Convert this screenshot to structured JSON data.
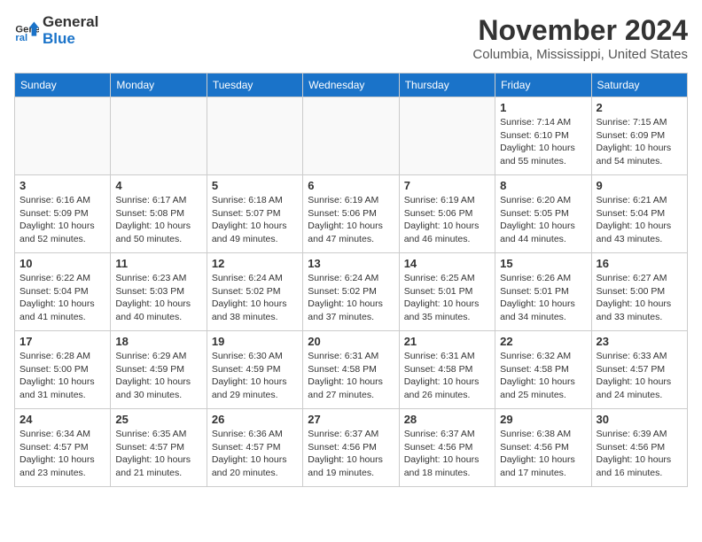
{
  "logo": {
    "line1": "General",
    "line2": "Blue"
  },
  "title": "November 2024",
  "location": "Columbia, Mississippi, United States",
  "days_of_week": [
    "Sunday",
    "Monday",
    "Tuesday",
    "Wednesday",
    "Thursday",
    "Friday",
    "Saturday"
  ],
  "weeks": [
    [
      {
        "day": "",
        "info": ""
      },
      {
        "day": "",
        "info": ""
      },
      {
        "day": "",
        "info": ""
      },
      {
        "day": "",
        "info": ""
      },
      {
        "day": "",
        "info": ""
      },
      {
        "day": "1",
        "info": "Sunrise: 7:14 AM\nSunset: 6:10 PM\nDaylight: 10 hours and 55 minutes."
      },
      {
        "day": "2",
        "info": "Sunrise: 7:15 AM\nSunset: 6:09 PM\nDaylight: 10 hours and 54 minutes."
      }
    ],
    [
      {
        "day": "3",
        "info": "Sunrise: 6:16 AM\nSunset: 5:09 PM\nDaylight: 10 hours and 52 minutes."
      },
      {
        "day": "4",
        "info": "Sunrise: 6:17 AM\nSunset: 5:08 PM\nDaylight: 10 hours and 50 minutes."
      },
      {
        "day": "5",
        "info": "Sunrise: 6:18 AM\nSunset: 5:07 PM\nDaylight: 10 hours and 49 minutes."
      },
      {
        "day": "6",
        "info": "Sunrise: 6:19 AM\nSunset: 5:06 PM\nDaylight: 10 hours and 47 minutes."
      },
      {
        "day": "7",
        "info": "Sunrise: 6:19 AM\nSunset: 5:06 PM\nDaylight: 10 hours and 46 minutes."
      },
      {
        "day": "8",
        "info": "Sunrise: 6:20 AM\nSunset: 5:05 PM\nDaylight: 10 hours and 44 minutes."
      },
      {
        "day": "9",
        "info": "Sunrise: 6:21 AM\nSunset: 5:04 PM\nDaylight: 10 hours and 43 minutes."
      }
    ],
    [
      {
        "day": "10",
        "info": "Sunrise: 6:22 AM\nSunset: 5:04 PM\nDaylight: 10 hours and 41 minutes."
      },
      {
        "day": "11",
        "info": "Sunrise: 6:23 AM\nSunset: 5:03 PM\nDaylight: 10 hours and 40 minutes."
      },
      {
        "day": "12",
        "info": "Sunrise: 6:24 AM\nSunset: 5:02 PM\nDaylight: 10 hours and 38 minutes."
      },
      {
        "day": "13",
        "info": "Sunrise: 6:24 AM\nSunset: 5:02 PM\nDaylight: 10 hours and 37 minutes."
      },
      {
        "day": "14",
        "info": "Sunrise: 6:25 AM\nSunset: 5:01 PM\nDaylight: 10 hours and 35 minutes."
      },
      {
        "day": "15",
        "info": "Sunrise: 6:26 AM\nSunset: 5:01 PM\nDaylight: 10 hours and 34 minutes."
      },
      {
        "day": "16",
        "info": "Sunrise: 6:27 AM\nSunset: 5:00 PM\nDaylight: 10 hours and 33 minutes."
      }
    ],
    [
      {
        "day": "17",
        "info": "Sunrise: 6:28 AM\nSunset: 5:00 PM\nDaylight: 10 hours and 31 minutes."
      },
      {
        "day": "18",
        "info": "Sunrise: 6:29 AM\nSunset: 4:59 PM\nDaylight: 10 hours and 30 minutes."
      },
      {
        "day": "19",
        "info": "Sunrise: 6:30 AM\nSunset: 4:59 PM\nDaylight: 10 hours and 29 minutes."
      },
      {
        "day": "20",
        "info": "Sunrise: 6:31 AM\nSunset: 4:58 PM\nDaylight: 10 hours and 27 minutes."
      },
      {
        "day": "21",
        "info": "Sunrise: 6:31 AM\nSunset: 4:58 PM\nDaylight: 10 hours and 26 minutes."
      },
      {
        "day": "22",
        "info": "Sunrise: 6:32 AM\nSunset: 4:58 PM\nDaylight: 10 hours and 25 minutes."
      },
      {
        "day": "23",
        "info": "Sunrise: 6:33 AM\nSunset: 4:57 PM\nDaylight: 10 hours and 24 minutes."
      }
    ],
    [
      {
        "day": "24",
        "info": "Sunrise: 6:34 AM\nSunset: 4:57 PM\nDaylight: 10 hours and 23 minutes."
      },
      {
        "day": "25",
        "info": "Sunrise: 6:35 AM\nSunset: 4:57 PM\nDaylight: 10 hours and 21 minutes."
      },
      {
        "day": "26",
        "info": "Sunrise: 6:36 AM\nSunset: 4:57 PM\nDaylight: 10 hours and 20 minutes."
      },
      {
        "day": "27",
        "info": "Sunrise: 6:37 AM\nSunset: 4:56 PM\nDaylight: 10 hours and 19 minutes."
      },
      {
        "day": "28",
        "info": "Sunrise: 6:37 AM\nSunset: 4:56 PM\nDaylight: 10 hours and 18 minutes."
      },
      {
        "day": "29",
        "info": "Sunrise: 6:38 AM\nSunset: 4:56 PM\nDaylight: 10 hours and 17 minutes."
      },
      {
        "day": "30",
        "info": "Sunrise: 6:39 AM\nSunset: 4:56 PM\nDaylight: 10 hours and 16 minutes."
      }
    ]
  ]
}
